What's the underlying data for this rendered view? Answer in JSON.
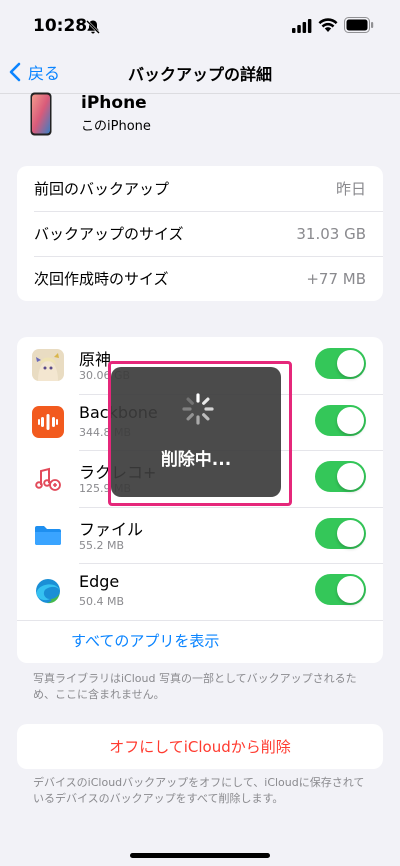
{
  "status": {
    "time": "10:28"
  },
  "nav": {
    "back_label": "戻る",
    "title": "バックアップの詳細"
  },
  "device": {
    "name": "iPhone",
    "subtitle": "このiPhone"
  },
  "info": [
    {
      "label": "前回のバックアップ",
      "value": "昨日"
    },
    {
      "label": "バックアップのサイズ",
      "value": "31.03 GB"
    },
    {
      "label": "次回作成時のサイズ",
      "value": "+77 MB"
    }
  ],
  "apps": [
    {
      "name": "原神",
      "size": "30.06 GB",
      "enabled": true
    },
    {
      "name": "Backbone",
      "size": "344.8 MB",
      "enabled": true
    },
    {
      "name": "ラクレコ+",
      "size": "125.9 MB",
      "enabled": true
    },
    {
      "name": "ファイル",
      "size": "55.2 MB",
      "enabled": true
    },
    {
      "name": "Edge",
      "size": "50.4 MB",
      "enabled": true
    }
  ],
  "show_all_label": "すべてのアプリを表示",
  "photos_note": "写真ライブラリはiCloud 写真の一部としてバックアップされるため、ここに含まれません。",
  "delete_label": "オフにしてiCloudから削除",
  "off_note": "デバイスのiCloudバックアップをオフにして、iCloudに保存されているデバイスのバックアップをすべて削除します。",
  "hud": {
    "text": "削除中..."
  },
  "colors": {
    "accent": "#0a84ff",
    "toggle_on": "#34c759",
    "destructive": "#ff3b30",
    "highlight": "#e5277a"
  }
}
